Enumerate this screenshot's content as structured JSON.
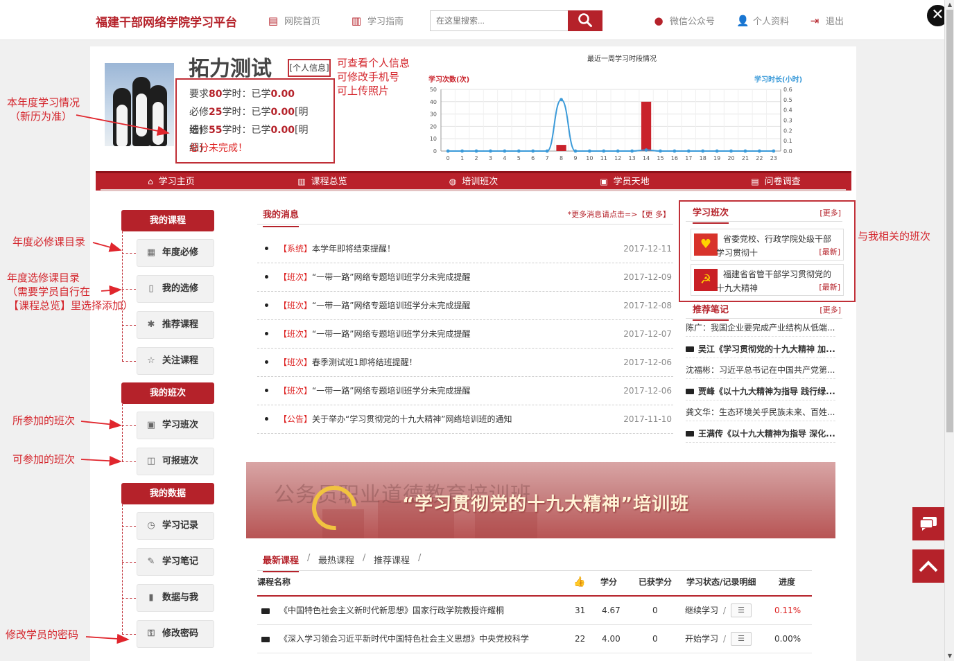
{
  "header": {
    "site_title": "福建干部网络学院学习平台",
    "nav_home": "网院首页",
    "nav_guide": "学习指南",
    "search_placeholder": "在这里搜索...",
    "wechat": "微信公众号",
    "profile": "个人资料",
    "logout": "退出"
  },
  "user": {
    "name": "拓力测试",
    "profile_link": "[个人信息]",
    "req_prefix": "要求",
    "req_hours": "80",
    "req_mid": "学时：已学",
    "req_done": "0.00",
    "must_prefix": "必修",
    "must_hours": "25",
    "must_mid": "学时：已学",
    "must_done": "0.00",
    "must_detail": "[明细]",
    "elect_prefix": "选修",
    "elect_hours": "55",
    "elect_mid": "学时：已学",
    "elect_done": "0.00",
    "elect_detail": "[明细]",
    "status": "总分未完成！"
  },
  "annotations": {
    "profile_1": "可查看个人信息",
    "profile_2": "可修改手机号",
    "profile_3": "可上传照片",
    "year_1": "本年度学习情况",
    "year_2": "（新历为准）",
    "must": "年度必修课目录",
    "elect_1": "年度选修课目录",
    "elect_2": "（需要学员自行在",
    "elect_3": "【课程总览】里选择添加）",
    "joined": "所参加的班次",
    "available": "可参加的班次",
    "password": "修改学员的密码",
    "related": "与我相关的班次"
  },
  "chart_data": {
    "type": "bar+line",
    "title": "最近一周学习时段情况",
    "ylabel_left": "学习次数(次)",
    "ylabel_right": "学习时长(小时)",
    "x": [
      0,
      1,
      2,
      3,
      4,
      5,
      6,
      7,
      8,
      9,
      10,
      11,
      12,
      13,
      14,
      15,
      16,
      17,
      18,
      19,
      20,
      21,
      22,
      23
    ],
    "ylim_left": [
      0,
      50
    ],
    "yticks_left": [
      0,
      10,
      20,
      30,
      40,
      50
    ],
    "ylim_right": [
      0,
      0.6
    ],
    "yticks_right": [
      "0.0",
      "0.1",
      "0.2",
      "0.3",
      "0.4",
      "0.5",
      "0.6"
    ],
    "bar_series": {
      "values": [
        0,
        0,
        0,
        0,
        0,
        0,
        0,
        0,
        5,
        0,
        0,
        0,
        0,
        0,
        40,
        0,
        0,
        0,
        0,
        0,
        0,
        0,
        0,
        0
      ],
      "color": "#c9222b"
    },
    "line_series": {
      "values": [
        0,
        0,
        0,
        0,
        0,
        0,
        0,
        0,
        0.5,
        0,
        0,
        0,
        0,
        0,
        0.01,
        0,
        0,
        0,
        0,
        0,
        0,
        0,
        0,
        0
      ],
      "color": "#3a9ad9"
    },
    "grid": true
  },
  "rednav": [
    "学习主页",
    "课程总览",
    "培训班次",
    "学员天地",
    "问卷调查"
  ],
  "menu": {
    "my_courses": "我的课程",
    "annual_required": "年度必修",
    "my_electives": "我的选修",
    "recommended": "推荐课程",
    "followed": "关注课程",
    "my_classes": "我的班次",
    "study_classes": "学习班次",
    "enrollable": "可报班次",
    "my_data": "我的数据",
    "records": "学习记录",
    "notes": "学习笔记",
    "data_and_me": "数据与我",
    "change_password": "修改密码"
  },
  "messages": {
    "title": "我的消息",
    "more": "*更多消息请点击=>【更 多】",
    "items": [
      {
        "tag": "【系统】",
        "text": "本学年即将结束提醒！",
        "date": "2017-12-11"
      },
      {
        "tag": "【班次】",
        "text": "“一带一路”网络专题培训班学分未完成提醒",
        "date": "2017-12-09"
      },
      {
        "tag": "【班次】",
        "text": "“一带一路”网络专题培训班学分未完成提醒",
        "date": "2017-12-08"
      },
      {
        "tag": "【班次】",
        "text": "“一带一路”网络专题培训班学分未完成提醒",
        "date": "2017-12-07"
      },
      {
        "tag": "【班次】",
        "text": "春季测试班1即将结班提醒！",
        "date": "2017-12-06"
      },
      {
        "tag": "【班次】",
        "text": "“一带一路”网络专题培训班学分未完成提醒",
        "date": "2017-12-06"
      },
      {
        "tag": "【公告】",
        "text": "关于举办“学习贯彻党的十九大精神”网络培训班的通知",
        "date": "2017-11-10"
      }
    ]
  },
  "classes": {
    "title": "学习班次",
    "more": "[更多]",
    "items": [
      {
        "name": "省委党校、行政学院处级干部学习贯彻十",
        "badge": "[最新]"
      },
      {
        "name": "福建省省管干部学习贯彻党的十九大精神",
        "badge": "[最新]"
      }
    ]
  },
  "notes": {
    "title": "推荐笔记",
    "more": "[更多]",
    "items": [
      {
        "text": "陈广：我国企业要完成产业结构从低端...",
        "video": false
      },
      {
        "text": "吴江《学习贯彻党的十九大精神 加...",
        "video": true
      },
      {
        "text": "沈福彬：习近平总书记在中国共产党第...",
        "video": false
      },
      {
        "text": "贾峰《以十九大精神为指导 践行绿...",
        "video": true
      },
      {
        "text": "龚文华：生态环境关乎民族未来、百姓...",
        "video": false
      },
      {
        "text": "王满传《以十九大精神为指导 深化...",
        "video": true
      }
    ]
  },
  "banner": {
    "bg_text": "公务员职业道德教育培训班",
    "main_text": "“学习贯彻党的十九大精神”培训班"
  },
  "courses": {
    "tabs": [
      "最新课程",
      "最热课程",
      "推荐课程"
    ],
    "sep": "/",
    "headers": {
      "name": "课程名称",
      "credit": "学分",
      "earned": "已获学分",
      "status": "学习状态/记录明细",
      "progress": "进度"
    },
    "rows": [
      {
        "name": "《中国特色社会主义新时代新思想》国家行政学院教授许耀桐",
        "likes": "31",
        "credit": "4.67",
        "earned": "0",
        "status": "继续学习",
        "progress": "0.11%"
      },
      {
        "name": "《深入学习领会习近平新时代中国特色社会主义思想》中央党校科学",
        "likes": "22",
        "credit": "4.00",
        "earned": "0",
        "status": "开始学习",
        "progress": "0.00%"
      }
    ]
  },
  "colors": {
    "brand": "#b5222a",
    "accent_blue": "#3a9ad9"
  }
}
